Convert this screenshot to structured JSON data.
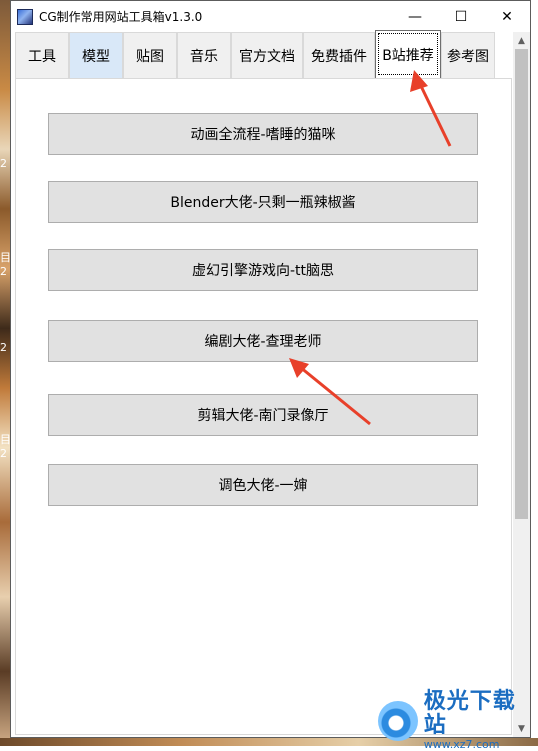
{
  "window": {
    "title": "CG制作常用网站工具箱v1.3.0",
    "controls": {
      "minimize": "—",
      "maximize": "☐",
      "close": "✕"
    }
  },
  "tabs": [
    {
      "label": "工具",
      "state": "normal"
    },
    {
      "label": "模型",
      "state": "hover"
    },
    {
      "label": "贴图",
      "state": "normal"
    },
    {
      "label": "音乐",
      "state": "normal"
    },
    {
      "label": "官方文档",
      "state": "normal"
    },
    {
      "label": "免费插件",
      "state": "normal"
    },
    {
      "label": "B站推荐",
      "state": "selected"
    },
    {
      "label": "参考图",
      "state": "normal"
    }
  ],
  "buttons": [
    {
      "label": "动画全流程-嗜睡的猫咪"
    },
    {
      "label": "Blender大佬-只剩一瓶辣椒酱"
    },
    {
      "label": "虚幻引擎游戏向-tt脑思"
    },
    {
      "label": "编剧大佬-查理老师"
    },
    {
      "label": "剪辑大佬-南门录像厅"
    },
    {
      "label": "调色大佬-一婶"
    }
  ],
  "annotations": {
    "arrow_color": "#e8402a"
  },
  "watermark": {
    "brand": "极光下载站",
    "url": "www.xz7.com"
  },
  "colors": {
    "tab_hover_bg": "#d9e8f8",
    "button_bg": "#e1e1e1",
    "button_border": "#adadad"
  }
}
